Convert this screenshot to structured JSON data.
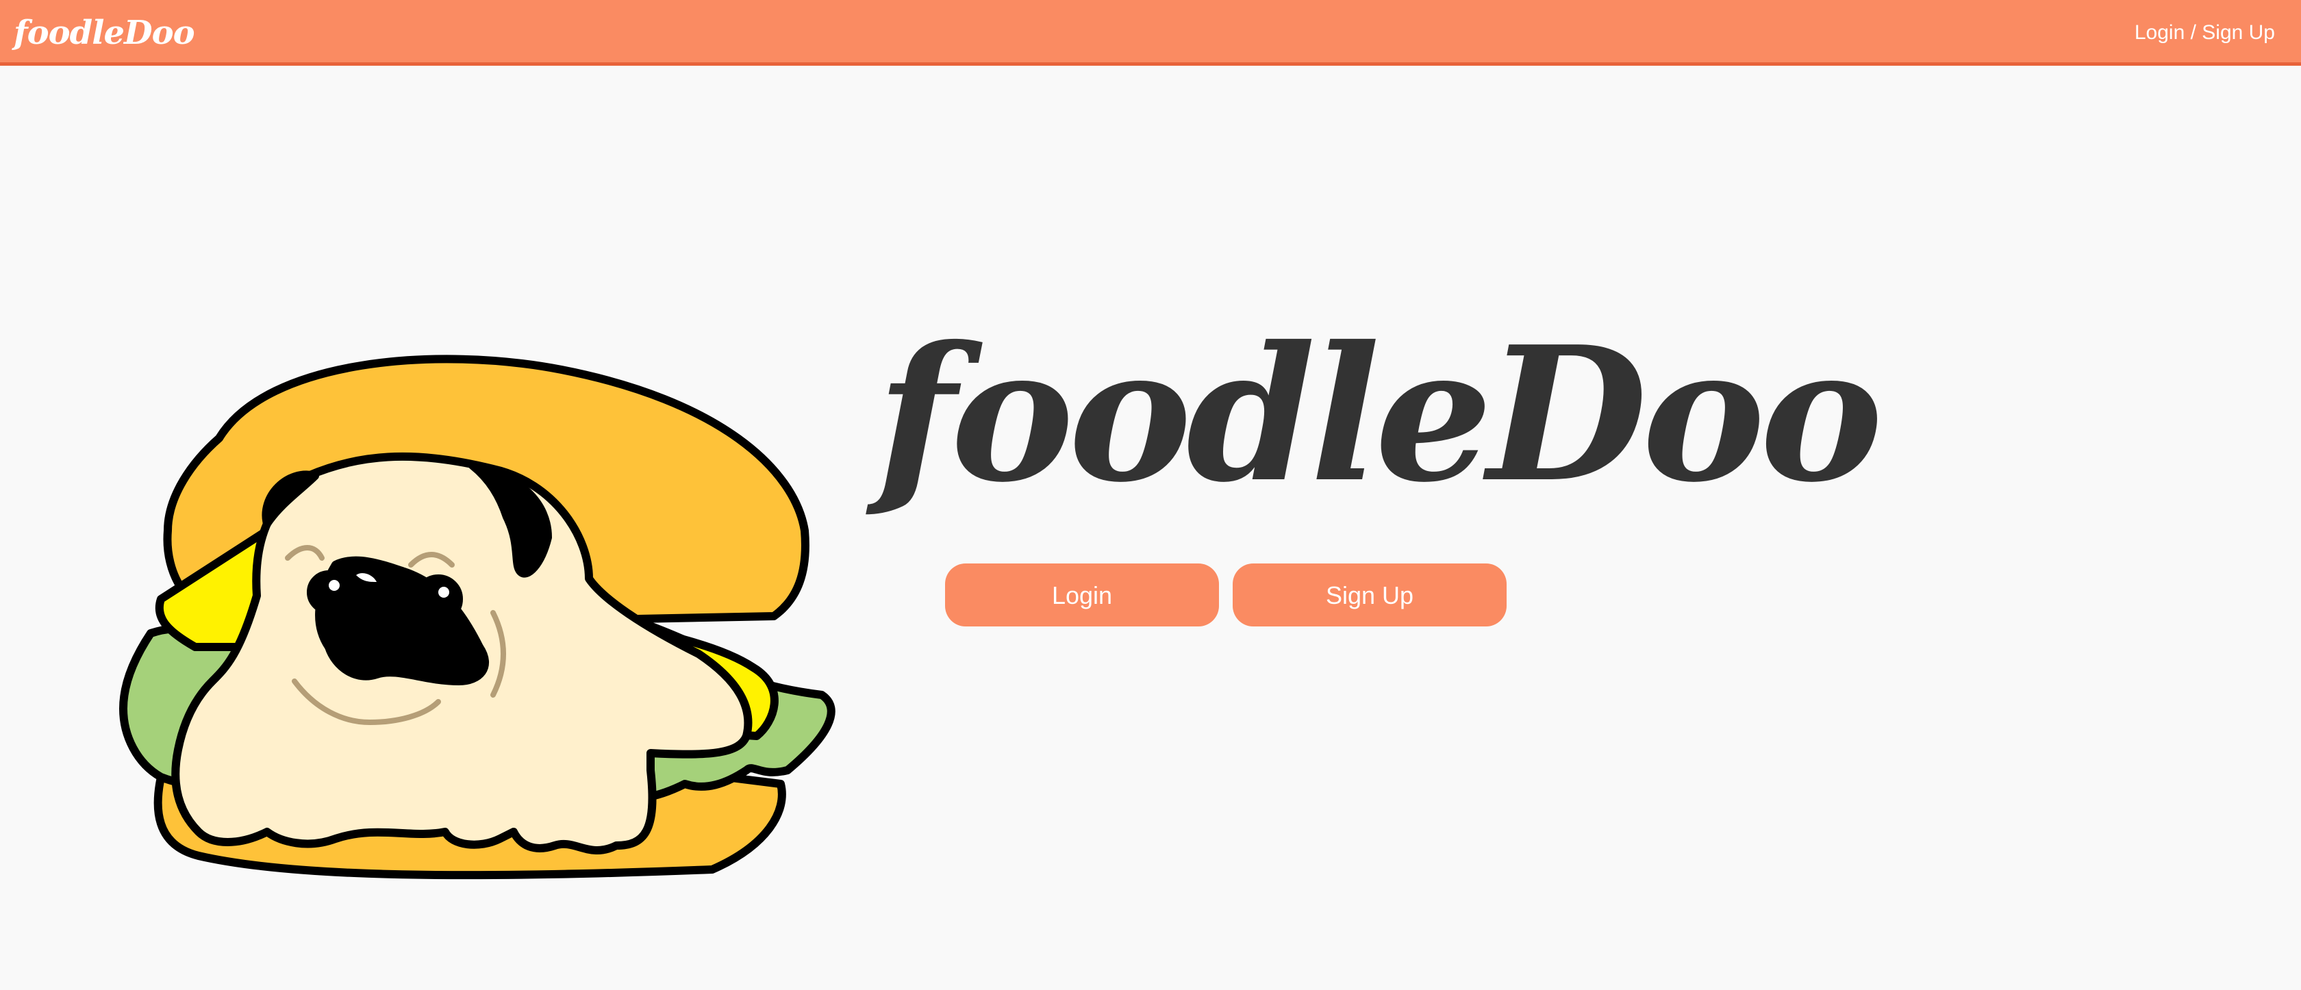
{
  "navbar": {
    "brand": "foodleDoo",
    "auth_link": "Login / Sign Up",
    "background_color": "#fa8b62"
  },
  "hero": {
    "illustration": "pug-in-burger-icon",
    "title": "foodleDoo",
    "login_label": "Login",
    "signup_label": "Sign Up",
    "button_color": "#fa8b62",
    "title_color": "#333333"
  }
}
